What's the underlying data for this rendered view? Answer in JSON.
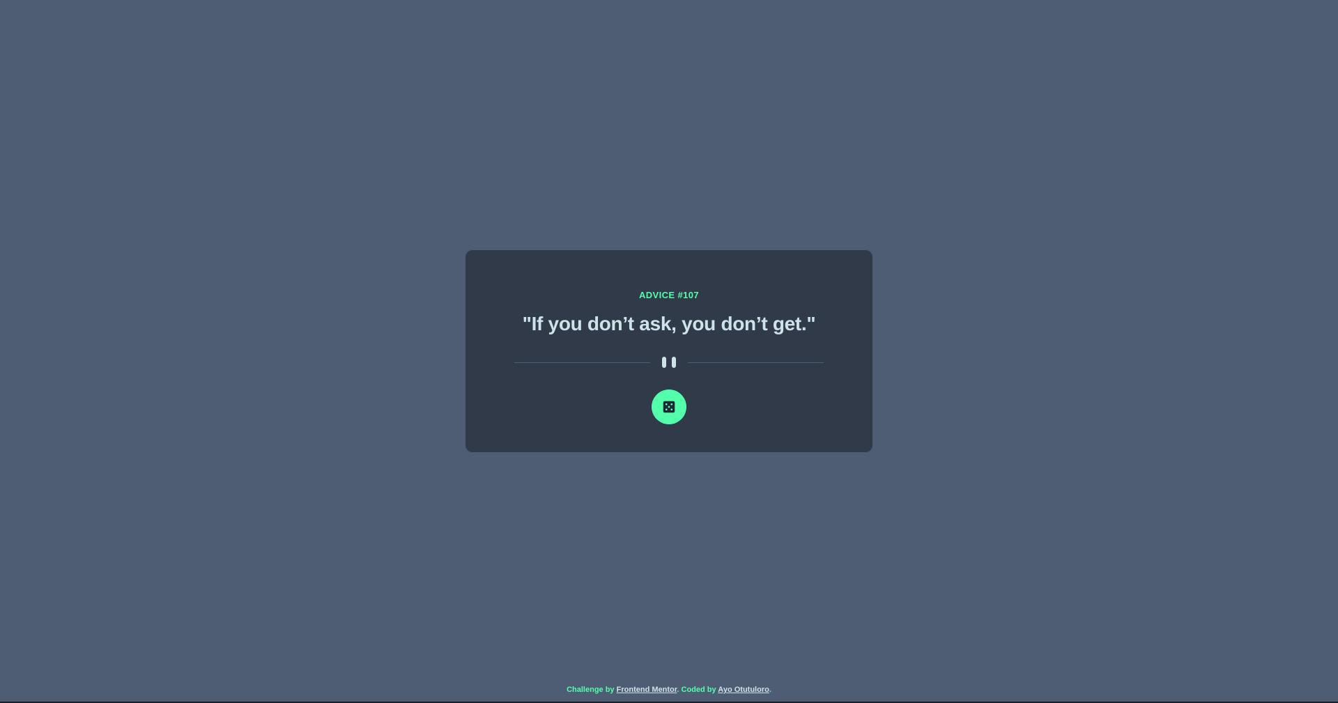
{
  "colors": {
    "page_background": "#4e5d73",
    "card_background": "#313a48",
    "accent_green": "#53ffaa",
    "text_light": "#cee3e9"
  },
  "advice": {
    "id_label": "ADVICE #107",
    "quote": "\"If you don’t ask, you don’t get.\""
  },
  "divider": {
    "icon": "pause-icon"
  },
  "button": {
    "icon": "dice-icon"
  },
  "attribution": {
    "prefix": "Challenge by",
    "link1": "Frontend Mentor",
    "middle": ". Coded by",
    "link2": "Ayo Otutuloro",
    "suffix": "."
  }
}
